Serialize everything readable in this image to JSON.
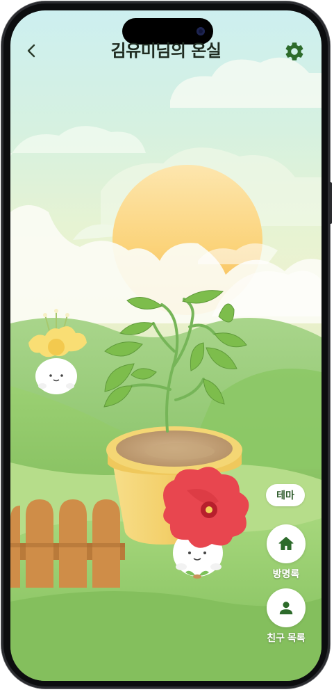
{
  "header": {
    "back_icon": "chevron-left-icon",
    "title": "김유미님의 온실",
    "settings_icon": "gear-icon"
  },
  "actions": {
    "theme_label": "테마",
    "guestbook": {
      "icon": "home-icon",
      "label": "방명록"
    },
    "friends": {
      "icon": "person-icon",
      "label": "친구 목록"
    }
  },
  "colors": {
    "accent": "#2d6b2b",
    "sky": "#cdeff0",
    "sun": "#fbce6e",
    "hill": "#8cc463",
    "pot": "#f3d16d",
    "fence": "#cc8a45",
    "hibiscus": "#e8464f",
    "daffodil": "#f8dd70"
  }
}
